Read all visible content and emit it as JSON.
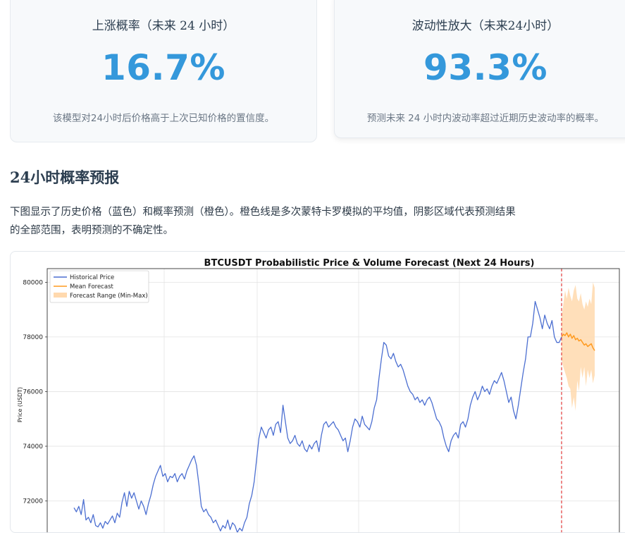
{
  "cards": [
    {
      "title": "上涨概率（未来 24 小时）",
      "value": "16.7%",
      "description": "该模型对24小时后价格高于上次已知价格的置信度。"
    },
    {
      "title": "波动性放大（未来24小时）",
      "value": "93.3%",
      "description": "预测未来 24 小时内波动率超过近期历史波动率的概率。"
    }
  ],
  "section": {
    "heading": "24小时概率预报",
    "line1": "下图显示了历史价格（蓝色）和概率预测（橙色）。橙色线是多次蒙特卡罗模拟的平均值，阴影区域代表预测结果",
    "line2": "的全部范围，表明预测的不确定性。"
  },
  "colors": {
    "accent": "#3498db",
    "historical": "#4c6fd1",
    "forecast": "#ff9a1f",
    "forecast_range": "#ffd9ae",
    "divider": "#e23a3a"
  },
  "chart_data": {
    "type": "line",
    "title": "BTCUSDT Probabilistic Price & Volume Forecast (Next 24 Hours)",
    "ylabel": "Price (USDT)",
    "xlabel": "",
    "ylim": [
      70800,
      80500
    ],
    "yticks": [
      72000,
      74000,
      76000,
      78000,
      80000
    ],
    "grid": true,
    "legend_position": "top-left",
    "legend": [
      "Historical Price",
      "Mean Forecast",
      "Forecast Range (Min-Max)"
    ],
    "historical": {
      "name": "Historical Price",
      "values": [
        71750,
        71600,
        71800,
        71500,
        72050,
        71300,
        71400,
        71200,
        71500,
        71100,
        71050,
        71200,
        71000,
        71250,
        71150,
        71300,
        71450,
        71200,
        71550,
        71400,
        71950,
        72300,
        71800,
        72350,
        72100,
        72300,
        72000,
        71700,
        72000,
        71800,
        71500,
        71900,
        72200,
        72600,
        72900,
        73100,
        73300,
        72900,
        73000,
        72700,
        72900,
        72850,
        73000,
        72700,
        72900,
        73000,
        72800,
        73100,
        73300,
        73500,
        73650,
        73300,
        72600,
        71800,
        71600,
        71700,
        71500,
        71400,
        71200,
        71300,
        71100,
        70900,
        71100,
        71000,
        71300,
        70950,
        71200,
        71100,
        70850,
        71000,
        70900,
        71200,
        71400,
        71900,
        72200,
        72700,
        73500,
        74300,
        74700,
        74500,
        74300,
        74600,
        74700,
        74400,
        74800,
        74900,
        74500,
        75500,
        74900,
        74300,
        74100,
        74200,
        74400,
        74100,
        74000,
        74200,
        73900,
        73800,
        74050,
        73900,
        74100,
        74200,
        73800,
        74400,
        74800,
        74900,
        74700,
        74800,
        74900,
        74700,
        74600,
        74400,
        74200,
        74300,
        73800,
        74200,
        74700,
        75000,
        74900,
        74700,
        75100,
        74800,
        74700,
        74600,
        74900,
        75400,
        75700,
        76500,
        77200,
        77800,
        77700,
        77300,
        77200,
        77400,
        77100,
        76900,
        77000,
        76800,
        76500,
        76200,
        76000,
        75900,
        75700,
        75800,
        75600,
        75700,
        75500,
        75700,
        75800,
        75600,
        75300,
        75000,
        74900,
        74700,
        74300,
        74000,
        73800,
        74200,
        74400,
        74500,
        74300,
        74800,
        74900,
        74700,
        75000,
        75500,
        75800,
        76000,
        75700,
        75900,
        76200,
        76000,
        76100,
        75900,
        76200,
        76400,
        76300,
        76500,
        76700,
        76400,
        76000,
        75600,
        75800,
        75300,
        75000,
        75500,
        76100,
        76700,
        77200,
        78000,
        78000,
        78500,
        79300,
        79000,
        78700,
        78300,
        78800,
        78500,
        78300,
        78600,
        78000,
        77800,
        77800,
        78000
      ]
    },
    "mean_forecast": {
      "name": "Mean Forecast",
      "values": [
        78000,
        78100,
        78050,
        78150,
        78000,
        78100,
        77950,
        78050,
        77900,
        77950,
        77850,
        77900,
        77800,
        77700,
        77750,
        77650,
        77700,
        77750,
        77600,
        77500
      ]
    },
    "forecast_range": {
      "name": "Forecast Range (Min-Max)",
      "upper": [
        78700,
        79200,
        79700,
        79400,
        79800,
        79500,
        79300,
        79700,
        79900,
        79400,
        79300,
        79600,
        79200,
        79000,
        79300,
        79100,
        79400,
        79200,
        80000,
        79800
      ],
      "lower": [
        77200,
        76900,
        76700,
        76500,
        76200,
        76100,
        75400,
        75800,
        75300,
        76400,
        76000,
        76900,
        76500,
        76900,
        76200,
        76800,
        76500,
        76800,
        76300,
        76600
      ]
    }
  }
}
